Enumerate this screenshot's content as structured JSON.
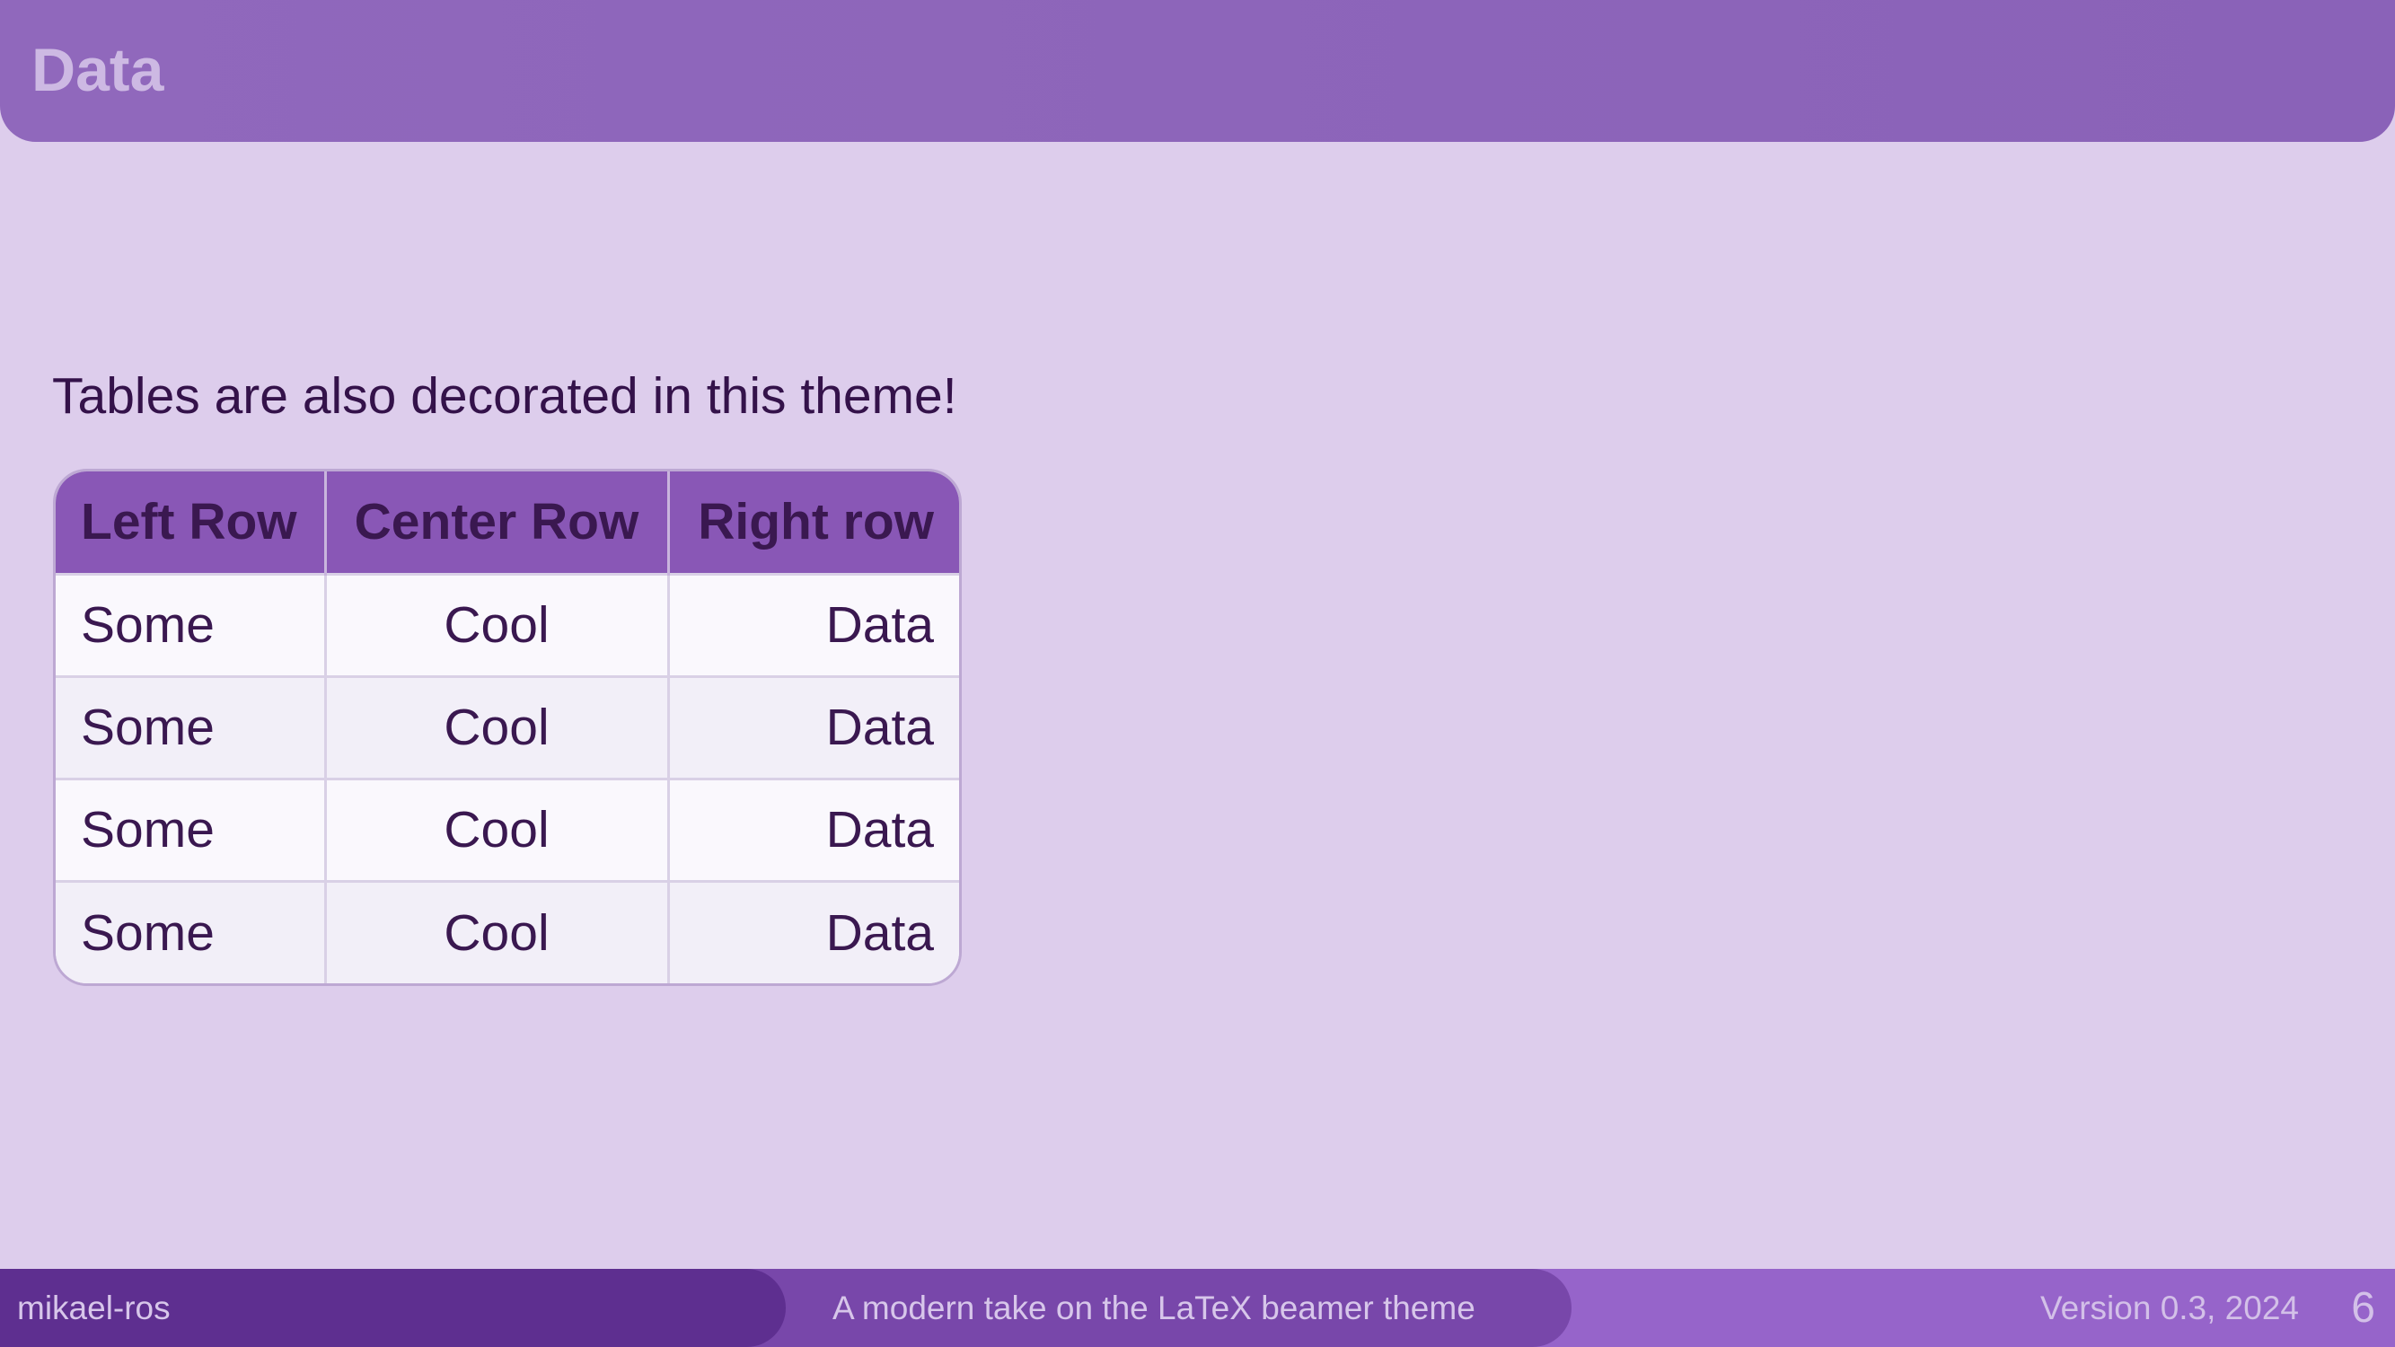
{
  "slide": {
    "title": "Data",
    "intro_text": "Tables are also decorated in this theme!"
  },
  "table": {
    "headers": [
      "Left Row",
      "Center Row",
      "Right row"
    ],
    "rows": [
      [
        "Some",
        "Cool",
        "Data"
      ],
      [
        "Some",
        "Cool",
        "Data"
      ],
      [
        "Some",
        "Cool",
        "Data"
      ],
      [
        "Some",
        "Cool",
        "Data"
      ]
    ]
  },
  "footer": {
    "author": "mikael-ros",
    "title": "A modern take on the LaTeX beamer theme",
    "date": "Version 0.3, 2024",
    "page_number": "6"
  },
  "colors": {
    "background": "#DDCDEC",
    "title_bar": "#8D65BA",
    "table_header": "#8957B6",
    "text_dark": "#34124A",
    "footer_left": "#5E2F90",
    "footer_mid": "#7847AA",
    "footer_right": "#9664CA"
  }
}
